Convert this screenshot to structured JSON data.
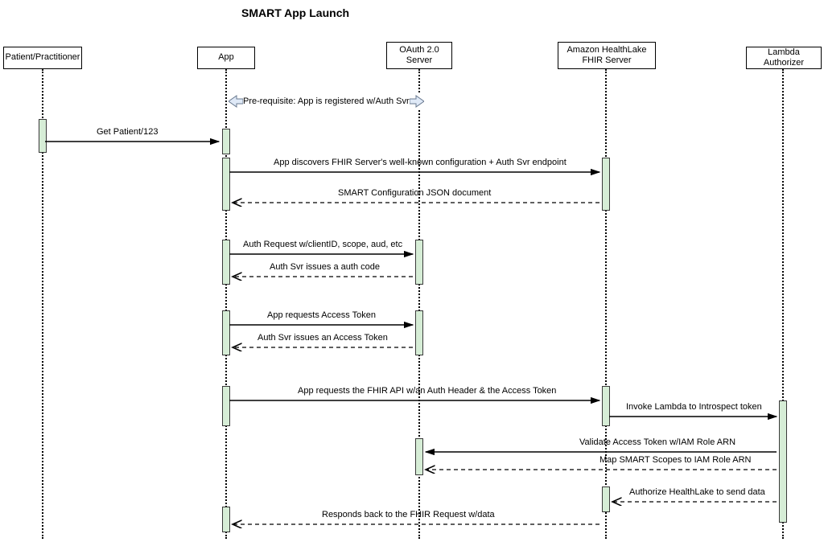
{
  "title": "SMART App Launch",
  "participants": {
    "p1": "Patient/Practitioner",
    "p2": "App",
    "p3": "OAuth 2.0\nServer",
    "p4": "Amazon HealthLake\nFHIR Server",
    "p5": "Lambda Authorizer"
  },
  "prerequisite": "Pre-requisite: App is registered w/Auth Svr",
  "messages": {
    "m1": "Get Patient/123",
    "m2": "App discovers FHIR Server's well-known configuration + Auth Svr endpoint",
    "m3": "SMART Configuration JSON document",
    "m4": "Auth Request w/clientID, scope, aud, etc",
    "m5": "Auth Svr issues a auth code",
    "m6": "App requests Access Token",
    "m7": "Auth Svr issues an Access Token",
    "m8": "App requests the FHIR API w/an Auth Header & the Access Token",
    "m9": "Invoke Lambda to Introspect token",
    "m10": "Validate Access Token w/IAM Role ARN",
    "m11": "Map SMART Scopes to IAM Role ARN",
    "m12": "Authorize HealthLake to send data",
    "m13": "Responds back to the FHIR Request w/data"
  }
}
